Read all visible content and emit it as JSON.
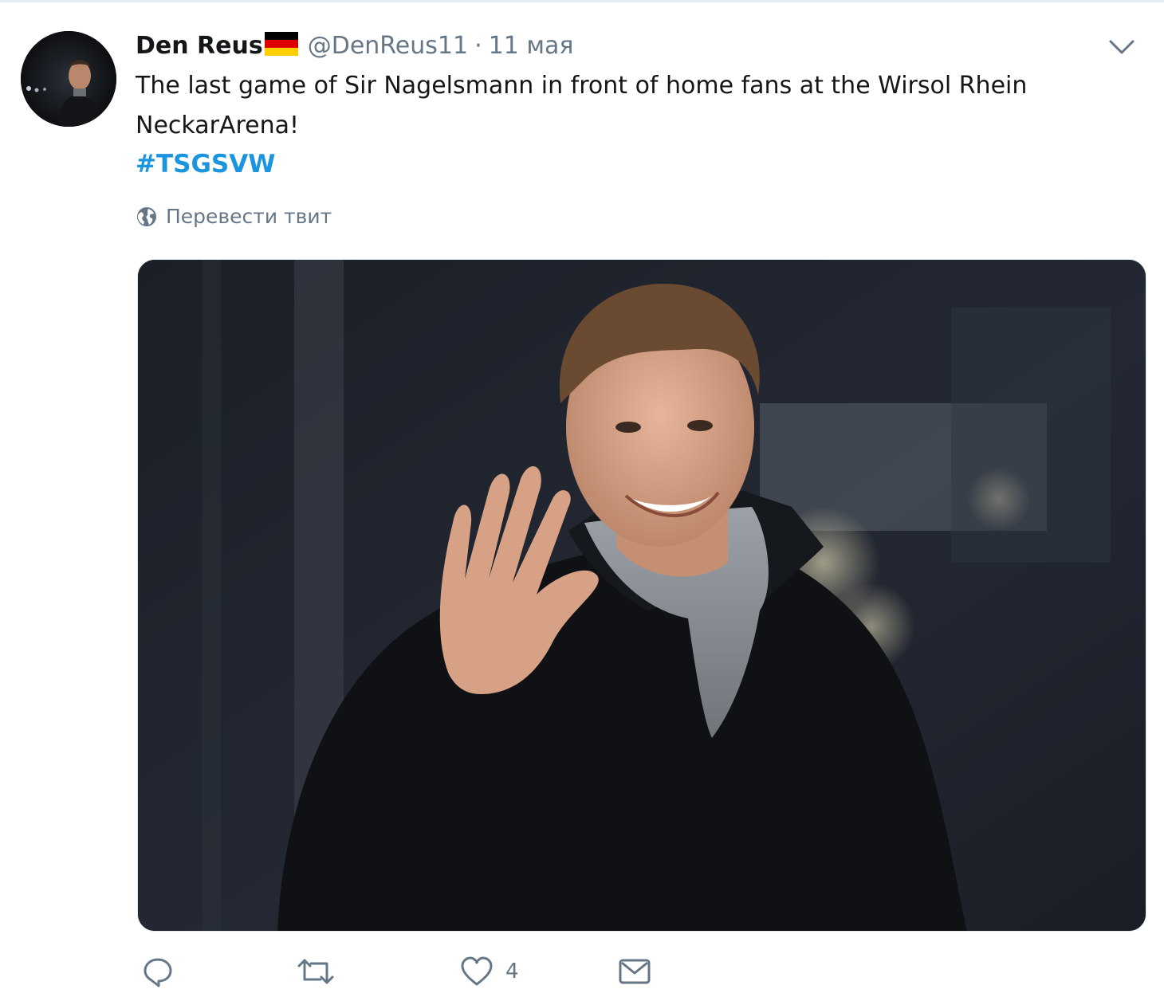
{
  "tweet": {
    "author_name": "Den Reus",
    "handle": "@DenReus11",
    "separator": "·",
    "date": "11 мая",
    "text": "The last game of Sir Nagelsmann in front of home fans at the Wirsol Rhein NeckarArena!",
    "hashtag": "#TSGSVW",
    "translate_label": "Перевести твит",
    "like_count": "4"
  },
  "colors": {
    "link": "#1b95e0",
    "secondary_text": "#657786",
    "primary_text": "#14171a",
    "flag": [
      "#000000",
      "#dd0000",
      "#ffce00"
    ]
  },
  "icons": {
    "menu": "chevron-down-icon",
    "translate": "globe-icon",
    "reply": "reply-icon",
    "retweet": "retweet-icon",
    "like": "heart-icon",
    "dm": "envelope-icon"
  }
}
